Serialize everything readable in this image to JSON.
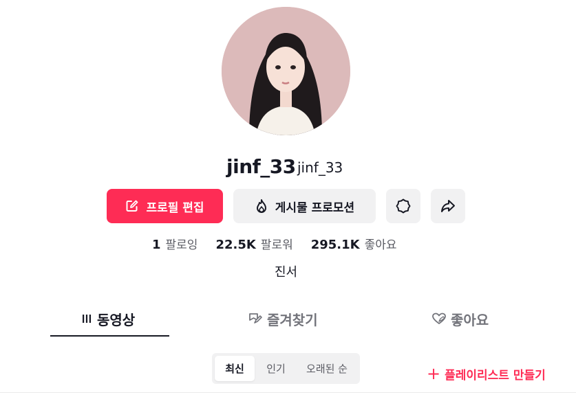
{
  "profile": {
    "username": "jinf_33",
    "nickname": "jinf_33",
    "avatar_icon": "profile-photo",
    "bio": "진서"
  },
  "actions": {
    "edit_profile": "프로필 편집",
    "promote_posts": "게시물 프로모션",
    "settings_icon": "gear-icon",
    "share_icon": "share-arrow-icon"
  },
  "stats": {
    "following": {
      "count": "1",
      "label": "팔로잉"
    },
    "followers": {
      "count": "22.5K",
      "label": "팔로워"
    },
    "likes": {
      "count": "295.1K",
      "label": "좋아요"
    }
  },
  "tabs": [
    {
      "label": "동영상",
      "icon": "grid-lines-icon",
      "active": true
    },
    {
      "label": "즐겨찾기",
      "icon": "bookmark-icon",
      "active": false
    },
    {
      "label": "좋아요",
      "icon": "heart-icon",
      "active": false
    }
  ],
  "sort": {
    "options": [
      "최신",
      "인기",
      "오래된 순"
    ],
    "selected": "최신"
  },
  "playlist": {
    "plus": "+",
    "label": "플레이리스트 만들기"
  },
  "colors": {
    "accent": "#fe2c55",
    "text": "#161823",
    "secondary_bg": "#f1f1f2",
    "muted_text": "#73747b"
  }
}
